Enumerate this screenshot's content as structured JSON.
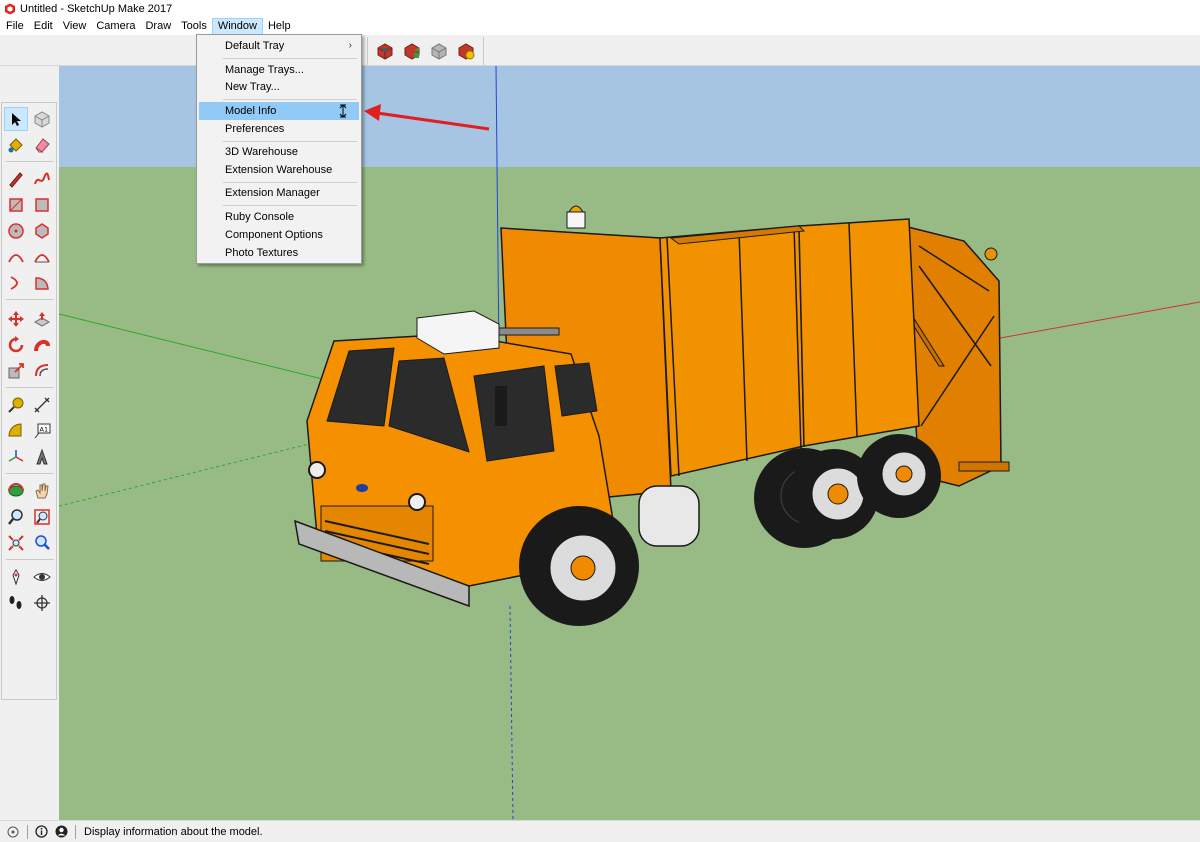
{
  "window": {
    "title": "Untitled - SketchUp Make 2017"
  },
  "menubar": {
    "items": [
      "File",
      "Edit",
      "View",
      "Camera",
      "Draw",
      "Tools",
      "Window",
      "Help"
    ],
    "active": "Window"
  },
  "window_menu": {
    "items": [
      {
        "label": "Default Tray",
        "submenu": true
      },
      {
        "label": "Manage Trays..."
      },
      {
        "label": "New Tray..."
      },
      {
        "label": "Model Info",
        "highlighted": true
      },
      {
        "label": "Preferences"
      },
      {
        "label": "3D Warehouse"
      },
      {
        "label": "Extension Warehouse"
      },
      {
        "label": "Extension Manager"
      },
      {
        "label": "Ruby Console"
      },
      {
        "label": "Component Options"
      },
      {
        "label": "Photo Textures"
      }
    ]
  },
  "statusbar": {
    "message": "Display information about the model."
  },
  "colors": {
    "sky": "#a5c5e2",
    "ground": "#98bb85",
    "truck_body": "#f08a00",
    "annotation_arrow": "#e02020",
    "menu_highlight": "#91c9f7"
  }
}
